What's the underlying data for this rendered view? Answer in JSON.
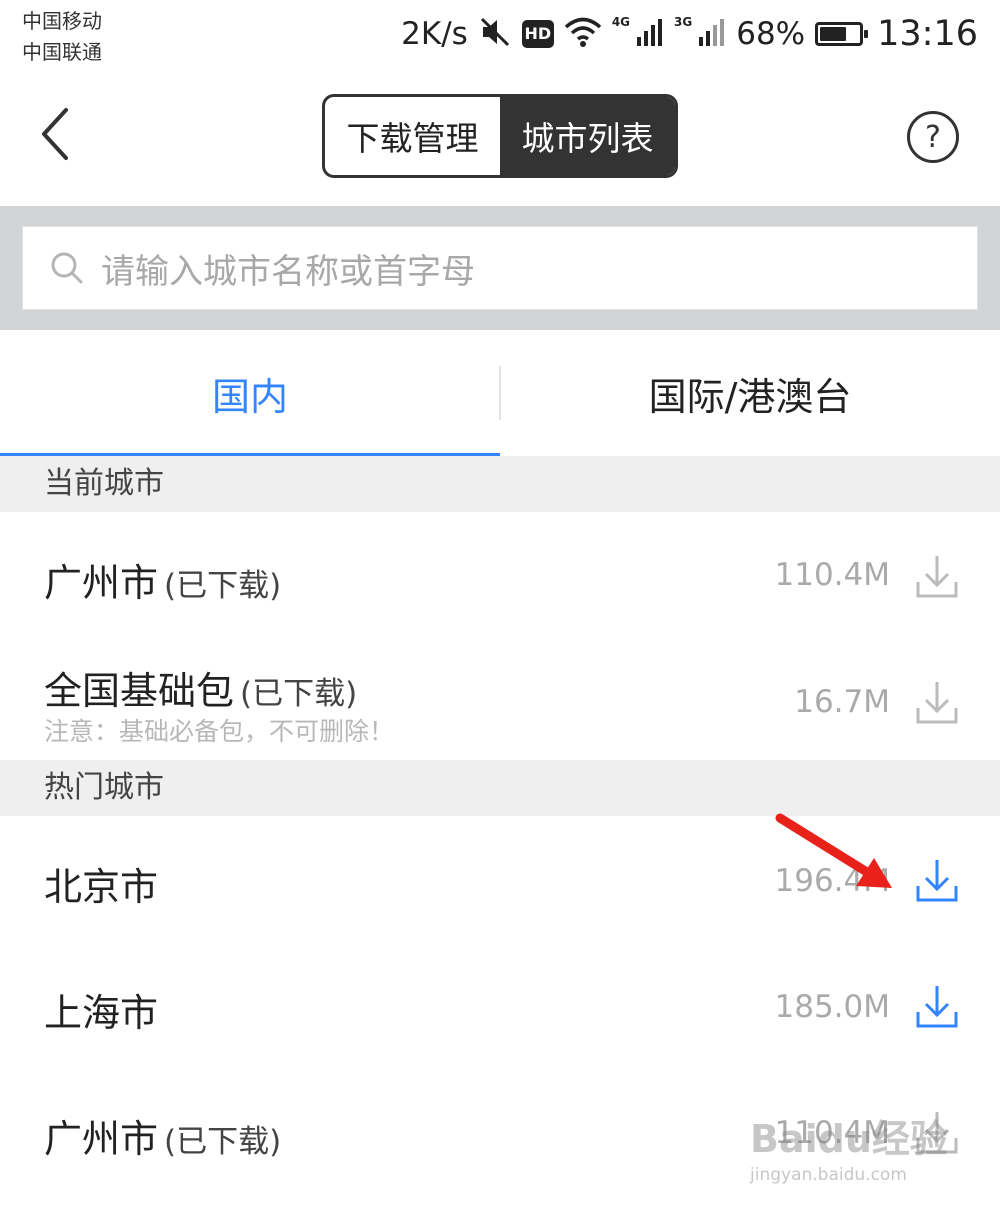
{
  "status_bar": {
    "carrier_1": "中国移动",
    "carrier_2": "中国联通",
    "net_speed": "2K/s",
    "hd": "HD",
    "net_4g": "4G",
    "net_3g": "3G",
    "battery": "68%",
    "battery_level": 0.68,
    "time": "13:16"
  },
  "header": {
    "segments": [
      {
        "label": "下载管理",
        "active": false
      },
      {
        "label": "城市列表",
        "active": true
      }
    ],
    "help": "?"
  },
  "search": {
    "placeholder": "请输入城市名称或首字母"
  },
  "tabs": [
    {
      "label": "国内",
      "active": true
    },
    {
      "label": "国际/港澳台",
      "active": false
    }
  ],
  "sections": {
    "current": "当前城市",
    "hot": "热门城市"
  },
  "current_cities": [
    {
      "name": "广州市",
      "status": "(已下载)",
      "size": "110.4M",
      "downloaded": true
    },
    {
      "name": "全国基础包",
      "status": "(已下载)",
      "note": "注意：基础必备包，不可删除！",
      "size": "16.7M",
      "downloaded": true
    }
  ],
  "hot_cities": [
    {
      "name": "北京市",
      "status": "",
      "size": "196.4M",
      "downloaded": false
    },
    {
      "name": "上海市",
      "status": "",
      "size": "185.0M",
      "downloaded": false
    },
    {
      "name": "广州市",
      "status": "(已下载)",
      "size": "110.4M",
      "downloaded": true
    }
  ],
  "watermark": {
    "main": "Baidu经验",
    "sub": "jingyan.baidu.com"
  },
  "colors": {
    "accent": "#3385ff",
    "arrow": "#e8221a",
    "downloaded_icon": "#bbbbbb"
  },
  "icons": {
    "back": "chevron-left-icon",
    "help": "question-circle-icon",
    "search": "search-icon",
    "download": "download-icon",
    "mute": "mute-icon",
    "wifi": "wifi-icon",
    "signal": "signal-icon",
    "battery": "battery-icon"
  }
}
